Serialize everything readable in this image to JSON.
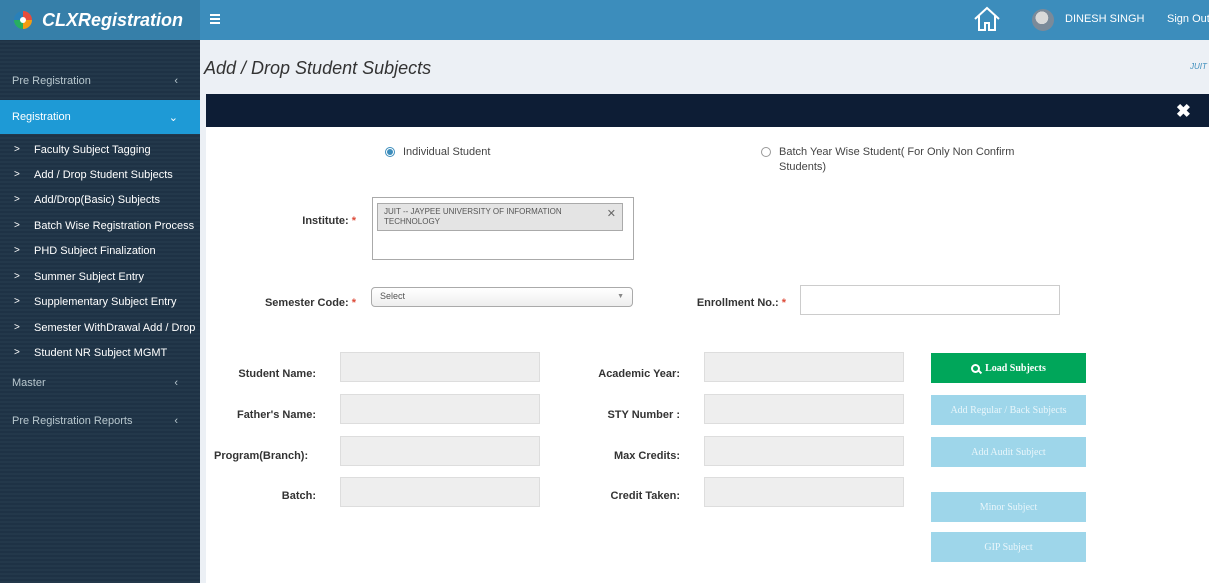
{
  "app": {
    "title": "CLXRegistration"
  },
  "header": {
    "user_name": "DINESH SINGH",
    "signout": "Sign Out"
  },
  "sidebar": {
    "pre_registration": "Pre Registration",
    "registration": "Registration",
    "items": [
      "Faculty Subject Tagging",
      "Add / Drop Student Subjects",
      "Add/Drop(Basic) Subjects",
      "Batch Wise Registration Process",
      "PHD Subject Finalization",
      "Summer Subject Entry",
      "Supplementary Subject Entry",
      "Semester WithDrawal Add / Drop",
      "Student NR Subject MGMT"
    ],
    "master": "Master",
    "pre_registration_reports": "Pre Registration Reports"
  },
  "page": {
    "title": "Add / Drop Student Subjects",
    "breadcrumb": "JUIT"
  },
  "form": {
    "radio_individual": "Individual Student",
    "radio_batch": "Batch Year Wise Student( For Only Non Confirm Students)",
    "institute_label": "Institute:",
    "institute_value": "JUIT -- JAYPEE UNIVERSITY OF INFORMATION TECHNOLOGY",
    "semester_label": "Semester Code:",
    "semester_value": "Select",
    "enrollment_label": "Enrollment No.:",
    "enrollment_value": "",
    "student_name_label": "Student Name:",
    "father_name_label": "Father's Name:",
    "program_label": "Program(Branch):",
    "batch_label": "Batch:",
    "academic_year_label": "Academic Year:",
    "sty_label": "STY Number :",
    "max_credits_label": "Max Credits:",
    "credit_taken_label": "Credit Taken:",
    "required_mark": "*"
  },
  "buttons": {
    "load": "Load Subjects",
    "add_regular": "Add Regular / Back Subjects",
    "add_audit": "Add Audit Subject",
    "minor": "Minor Subject",
    "gip": "GIP Subject"
  },
  "colors": {
    "topbar": "#3c8dbc",
    "sidebar": "#1f3447",
    "active_menu": "#1e9ad6",
    "panel_header": "#0d1d35",
    "green": "#00a65a"
  }
}
